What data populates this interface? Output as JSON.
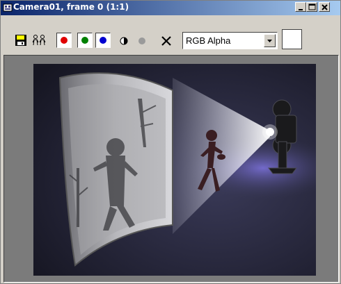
{
  "window": {
    "title": "Camera01, frame 0 (1:1)",
    "title_icon": "render-frame-icon",
    "controls": [
      "minimize-icon",
      "maximize-icon",
      "close-icon"
    ]
  },
  "toolbar": {
    "buttons": [
      {
        "name": "save-bitmap-button",
        "icon": "floppy-disk-icon"
      },
      {
        "name": "clone-window-button",
        "icon": "clone-people-icon"
      },
      {
        "name": "red-channel-button",
        "icon": "red-dot-icon",
        "color": "#e00000"
      },
      {
        "name": "green-channel-button",
        "icon": "green-dot-icon",
        "color": "#008000"
      },
      {
        "name": "blue-channel-button",
        "icon": "blue-dot-icon",
        "color": "#0000d0"
      },
      {
        "name": "monochrome-button",
        "icon": "half-circle-icon"
      },
      {
        "name": "alpha-channel-button",
        "icon": "gray-dot-icon"
      },
      {
        "name": "clear-button",
        "icon": "x-icon"
      }
    ],
    "channel_display": {
      "selected": "RGB Alpha"
    },
    "background_color_swatch": "#ffffff"
  },
  "viewport": {
    "background": "#7b7b7b",
    "render": {
      "description_icon": "rendered-image",
      "colors": {
        "backdrop": "#2a2a40",
        "floor_glow": "#6a62c0",
        "beam": "#f4f4ff"
      }
    }
  }
}
